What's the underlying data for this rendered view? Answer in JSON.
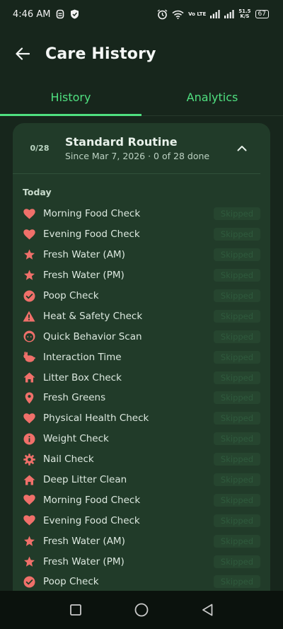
{
  "status_bar": {
    "time": "4:46 AM",
    "network_label": "Vo LTE",
    "net_speed_value": "51.5",
    "net_speed_unit": "K/S",
    "battery": "67"
  },
  "header": {
    "title": "Care History"
  },
  "tabs": [
    {
      "label": "History",
      "active": true
    },
    {
      "label": "Analytics",
      "active": false
    }
  ],
  "routine": {
    "progress": "0/28",
    "title": "Standard Routine",
    "subtitle": "Since Mar 7, 2026 · 0 of 28 done",
    "section_label": "Today",
    "tasks": [
      {
        "name": "Morning Food Check",
        "icon": "heart-icon",
        "status": "Skipped"
      },
      {
        "name": "Evening Food Check",
        "icon": "heart-icon",
        "status": "Skipped"
      },
      {
        "name": "Fresh Water (AM)",
        "icon": "star-icon",
        "status": "Skipped"
      },
      {
        "name": "Fresh Water (PM)",
        "icon": "star-icon",
        "status": "Skipped"
      },
      {
        "name": "Poop Check",
        "icon": "check-circle-icon",
        "status": "Skipped"
      },
      {
        "name": "Heat & Safety Check",
        "icon": "warning-icon",
        "status": "Skipped"
      },
      {
        "name": "Quick Behavior Scan",
        "icon": "face-icon",
        "status": "Skipped"
      },
      {
        "name": "Interaction Time",
        "icon": "pet-icon",
        "status": "Skipped"
      },
      {
        "name": "Litter Box Check",
        "icon": "home-icon",
        "status": "Skipped"
      },
      {
        "name": "Fresh Greens",
        "icon": "location-pin-icon",
        "status": "Skipped"
      },
      {
        "name": "Physical Health Check",
        "icon": "heart-icon",
        "status": "Skipped"
      },
      {
        "name": "Weight Check",
        "icon": "info-icon",
        "status": "Skipped"
      },
      {
        "name": "Nail Check",
        "icon": "gear-icon",
        "status": "Skipped"
      },
      {
        "name": "Deep Litter Clean",
        "icon": "home-icon",
        "status": "Skipped"
      },
      {
        "name": "Morning Food Check",
        "icon": "heart-icon",
        "status": "Skipped"
      },
      {
        "name": "Evening Food Check",
        "icon": "heart-icon",
        "status": "Skipped"
      },
      {
        "name": "Fresh Water (AM)",
        "icon": "star-icon",
        "status": "Skipped"
      },
      {
        "name": "Fresh Water (PM)",
        "icon": "star-icon",
        "status": "Skipped"
      },
      {
        "name": "Poop Check",
        "icon": "check-circle-icon",
        "status": "Skipped"
      }
    ]
  },
  "colors": {
    "background": "#17261c",
    "card": "#213b29",
    "accent": "#4fe080",
    "icon": "#f0706a",
    "nav_bar": "#0b120d"
  }
}
